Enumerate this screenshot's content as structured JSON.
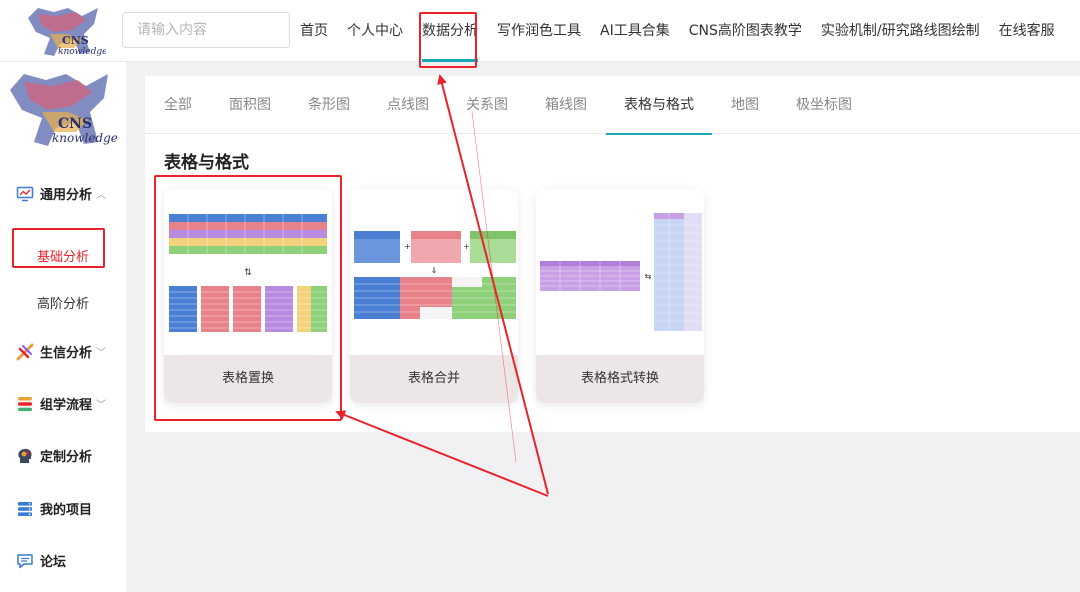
{
  "header": {
    "logo_text": "CNS knowledge",
    "search_placeholder": "请输入内容",
    "nav": [
      {
        "label": "首页"
      },
      {
        "label": "个人中心"
      },
      {
        "label": "数据分析",
        "active": true
      },
      {
        "label": "写作润色工具"
      },
      {
        "label": "AI工具合集"
      },
      {
        "label": "CNS高阶图表教学"
      },
      {
        "label": "实验机制/研究路线图绘制"
      },
      {
        "label": "在线客服"
      }
    ]
  },
  "sidebar": {
    "logo_text": "CNS knowledge",
    "items": [
      {
        "label": "通用分析",
        "icon": "chart-monitor-icon",
        "expanded": true
      },
      {
        "label": "基础分析",
        "sub": true,
        "active": true
      },
      {
        "label": "高阶分析",
        "sub": true
      },
      {
        "label": "生信分析",
        "icon": "dna-icon",
        "chevron": true
      },
      {
        "label": "组学流程",
        "icon": "layers-icon",
        "chevron": true
      },
      {
        "label": "定制分析",
        "icon": "brain-icon"
      },
      {
        "label": "我的项目",
        "icon": "server-icon"
      },
      {
        "label": "论坛",
        "icon": "chat-icon"
      }
    ]
  },
  "main": {
    "tabs": [
      {
        "label": "全部"
      },
      {
        "label": "面积图"
      },
      {
        "label": "条形图"
      },
      {
        "label": "点线图"
      },
      {
        "label": "关系图"
      },
      {
        "label": "箱线图"
      },
      {
        "label": "表格与格式",
        "active": true
      },
      {
        "label": "地图"
      },
      {
        "label": "极坐标图"
      }
    ],
    "section_title": "表格与格式",
    "cards": [
      {
        "label": "表格置换"
      },
      {
        "label": "表格合并"
      },
      {
        "label": "表格格式转换"
      }
    ]
  },
  "annotations": {
    "highlight_color": "#e8232a"
  },
  "colors": {
    "accent": "#1aa9b7"
  }
}
